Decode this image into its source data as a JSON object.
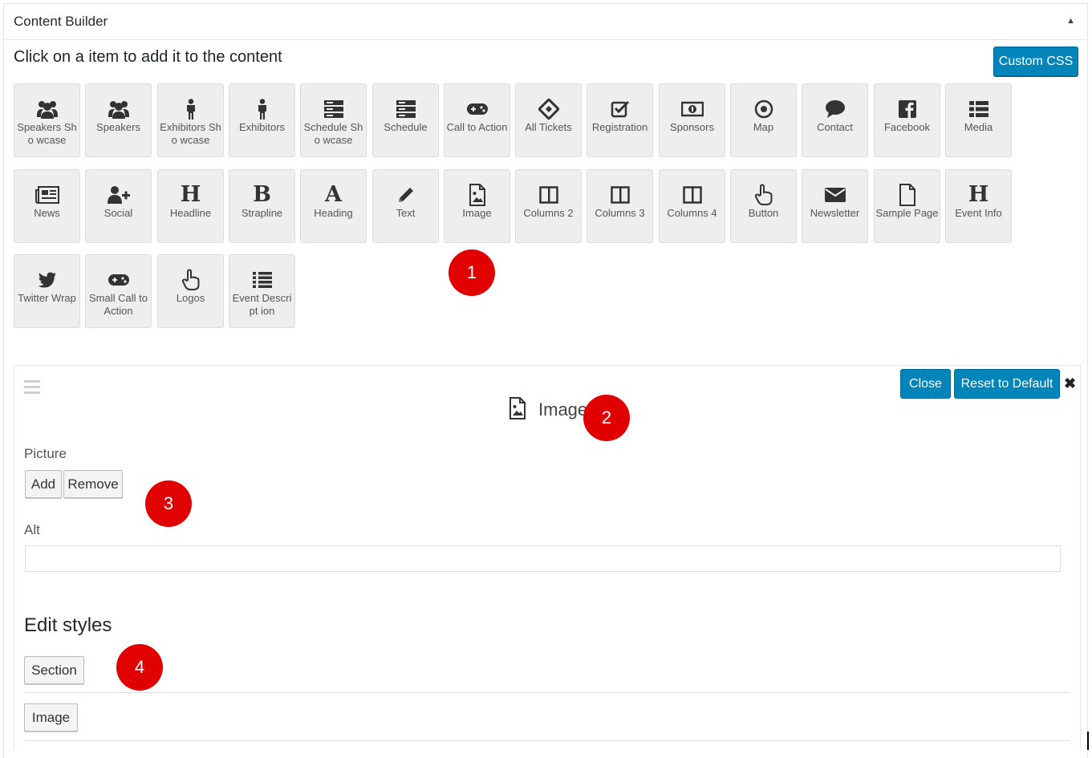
{
  "header": {
    "title": "Content Builder"
  },
  "subtitle": "Click on a item to add it to the content",
  "custom_css_label": "Custom CSS",
  "tiles": [
    {
      "label": "Speakers Sho wcase",
      "icon": "users-icon"
    },
    {
      "label": "Speakers",
      "icon": "users-icon"
    },
    {
      "label": "Exhibitors Sho wcase",
      "icon": "person-icon"
    },
    {
      "label": "Exhibitors",
      "icon": "person-icon"
    },
    {
      "label": "Schedule Sho wcase",
      "icon": "server-icon"
    },
    {
      "label": "Schedule",
      "icon": "server-icon"
    },
    {
      "label": "Call to Action",
      "icon": "gamepad-icon"
    },
    {
      "label": "All Tickets",
      "icon": "ticket-icon"
    },
    {
      "label": "Registration",
      "icon": "checkbox-icon"
    },
    {
      "label": "Sponsors",
      "icon": "money-icon"
    },
    {
      "label": "Map",
      "icon": "dot-circle-icon"
    },
    {
      "label": "Contact",
      "icon": "comment-icon"
    },
    {
      "label": "Facebook",
      "icon": "facebook-icon"
    },
    {
      "label": "Media",
      "icon": "list-icon"
    },
    {
      "label": "News",
      "icon": "newspaper-icon"
    },
    {
      "label": "Social",
      "icon": "user-plus-icon"
    },
    {
      "label": "Headline",
      "icon": "header-icon",
      "glyph": "H"
    },
    {
      "label": "Strapline",
      "icon": "bold-icon",
      "glyph": "B"
    },
    {
      "label": "Heading",
      "icon": "font-icon",
      "glyph": "A"
    },
    {
      "label": "Text",
      "icon": "pencil-icon"
    },
    {
      "label": "Image",
      "icon": "image-file-icon"
    },
    {
      "label": "Columns 2",
      "icon": "columns-icon"
    },
    {
      "label": "Columns 3",
      "icon": "columns-icon"
    },
    {
      "label": "Columns 4",
      "icon": "columns-icon"
    },
    {
      "label": "Button",
      "icon": "hand-pointer-icon"
    },
    {
      "label": "Newsletter",
      "icon": "envelope-icon"
    },
    {
      "label": "Sample Page",
      "icon": "file-icon"
    },
    {
      "label": "Event Info",
      "icon": "header-icon",
      "glyph": "H"
    },
    {
      "label": "Twitter Wrap",
      "icon": "twitter-icon"
    },
    {
      "label": "Small Call to Action",
      "icon": "gamepad-icon"
    },
    {
      "label": "Logos",
      "icon": "hand-pointer-icon"
    },
    {
      "label": "Event Descript ion",
      "icon": "list-ul-icon"
    }
  ],
  "markers": [
    "1",
    "2",
    "3",
    "4"
  ],
  "panel": {
    "close_label": "Close",
    "reset_label": "Reset to Default",
    "close_x": "✖",
    "title": "Image",
    "picture_label": "Picture",
    "add_label": "Add",
    "remove_label": "Remove",
    "alt_label": "Alt",
    "alt_value": "",
    "edit_styles_heading": "Edit styles",
    "style_buttons": [
      "Section",
      "Image"
    ]
  },
  "colors": {
    "primary_button": "#0085ba",
    "marker": "#e00000",
    "tile_bg": "#eeeeee"
  }
}
